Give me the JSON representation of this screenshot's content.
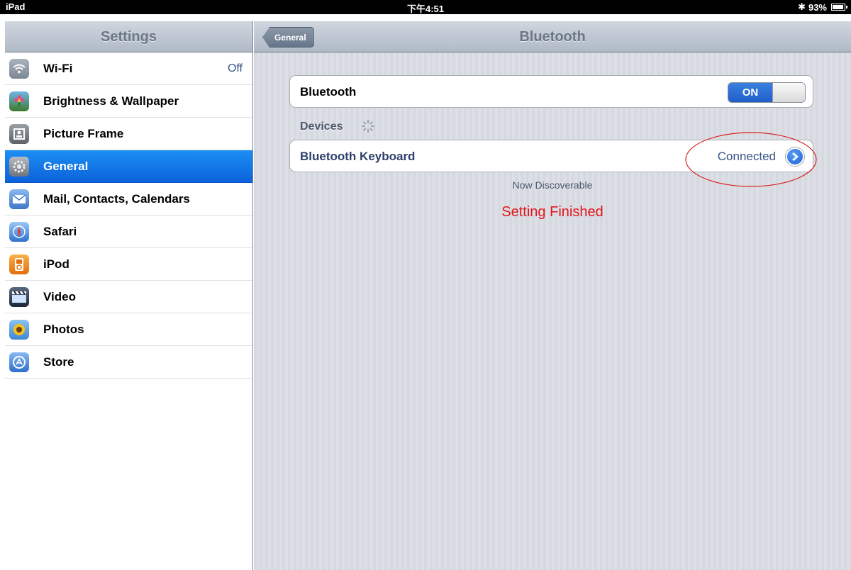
{
  "statusbar": {
    "device": "iPad",
    "time": "下午4:51",
    "battery": "93%",
    "battery_level": 0.93
  },
  "sidebar": {
    "title": "Settings",
    "items": [
      {
        "label": "Wi-Fi",
        "value": "Off",
        "icon": "wifi-icon",
        "color": "#8e98a4"
      },
      {
        "label": "Brightness & Wallpaper",
        "icon": "flower-icon",
        "color": "#5b9b3c"
      },
      {
        "label": "Picture Frame",
        "icon": "picture-frame-icon",
        "color": "#7a7f86"
      },
      {
        "label": "General",
        "icon": "gear-icon",
        "color": "#8e939a",
        "selected": true
      },
      {
        "label": "Mail, Contacts, Calendars",
        "icon": "mail-icon",
        "color": "#5b8fd6"
      },
      {
        "label": "Safari",
        "icon": "compass-icon",
        "color": "#4f90de"
      },
      {
        "label": "iPod",
        "icon": "ipod-icon",
        "color": "#f08a1c"
      },
      {
        "label": "Video",
        "icon": "clapper-icon",
        "color": "#2e3b4d"
      },
      {
        "label": "Photos",
        "icon": "sunflower-icon",
        "color": "#5b9de0"
      },
      {
        "label": "Store",
        "icon": "app-store-icon",
        "color": "#4a84d8"
      }
    ]
  },
  "main": {
    "back_label": "General",
    "title": "Bluetooth",
    "bluetooth_row_label": "Bluetooth",
    "toggle_label": "ON",
    "devices_header": "Devices",
    "device_name": "Bluetooth Keyboard",
    "device_status": "Connected",
    "discoverable_text": "Now Discoverable",
    "annotation": "Setting Finished"
  },
  "colors": {
    "accent_blue": "#1b72e8",
    "annotation_red": "#e3151a"
  }
}
